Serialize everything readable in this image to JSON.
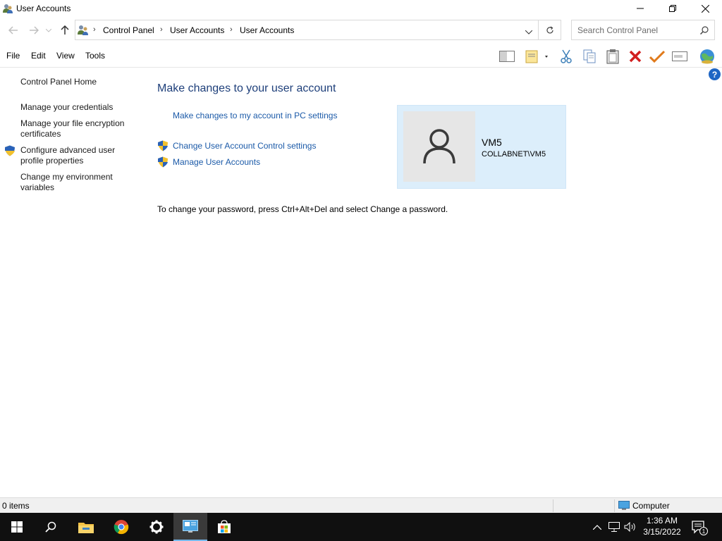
{
  "window": {
    "title": "User Accounts"
  },
  "address": {
    "crumbs": [
      "Control Panel",
      "User Accounts",
      "User Accounts"
    ],
    "search_placeholder": "Search Control Panel"
  },
  "menu": [
    "File",
    "Edit",
    "View",
    "Tools"
  ],
  "left_pane": {
    "home": "Control Panel Home",
    "links": [
      "Manage your credentials",
      "Manage your file encryption certificates",
      "Configure advanced user profile properties",
      "Change my environment variables"
    ]
  },
  "main": {
    "heading": "Make changes to your user account",
    "links": [
      "Make changes to my account in PC settings",
      "Change User Account Control settings",
      "Manage User Accounts"
    ],
    "password_note": "To change your password, press Ctrl+Alt+Del and select Change a password."
  },
  "user": {
    "name": "VM5",
    "domain": "COLLABNET\\VM5"
  },
  "status": {
    "items": "0 items",
    "zone": "Computer"
  },
  "taskbar": {
    "time": "1:36 AM",
    "date": "3/15/2022",
    "notifications": "1"
  },
  "help": "?",
  "icons": {
    "titlebar": [
      "user-accounts-icon",
      "minimize-icon",
      "maximize-icon",
      "close-icon"
    ],
    "toolbar": [
      "preview-pane-icon",
      "properties-icon",
      "cut-icon",
      "copy-icon",
      "paste-icon",
      "delete-icon",
      "check-icon",
      "rename-icon",
      "globe-icon"
    ],
    "taskbar": [
      "windows-start-icon",
      "search-icon",
      "file-explorer-icon",
      "chrome-icon",
      "settings-icon",
      "control-panel-icon",
      "store-icon"
    ]
  },
  "colors": {
    "heading": "#1e3f7a",
    "link": "#1b5aa8",
    "card": "#dceefb",
    "taskbar": "#101010"
  }
}
